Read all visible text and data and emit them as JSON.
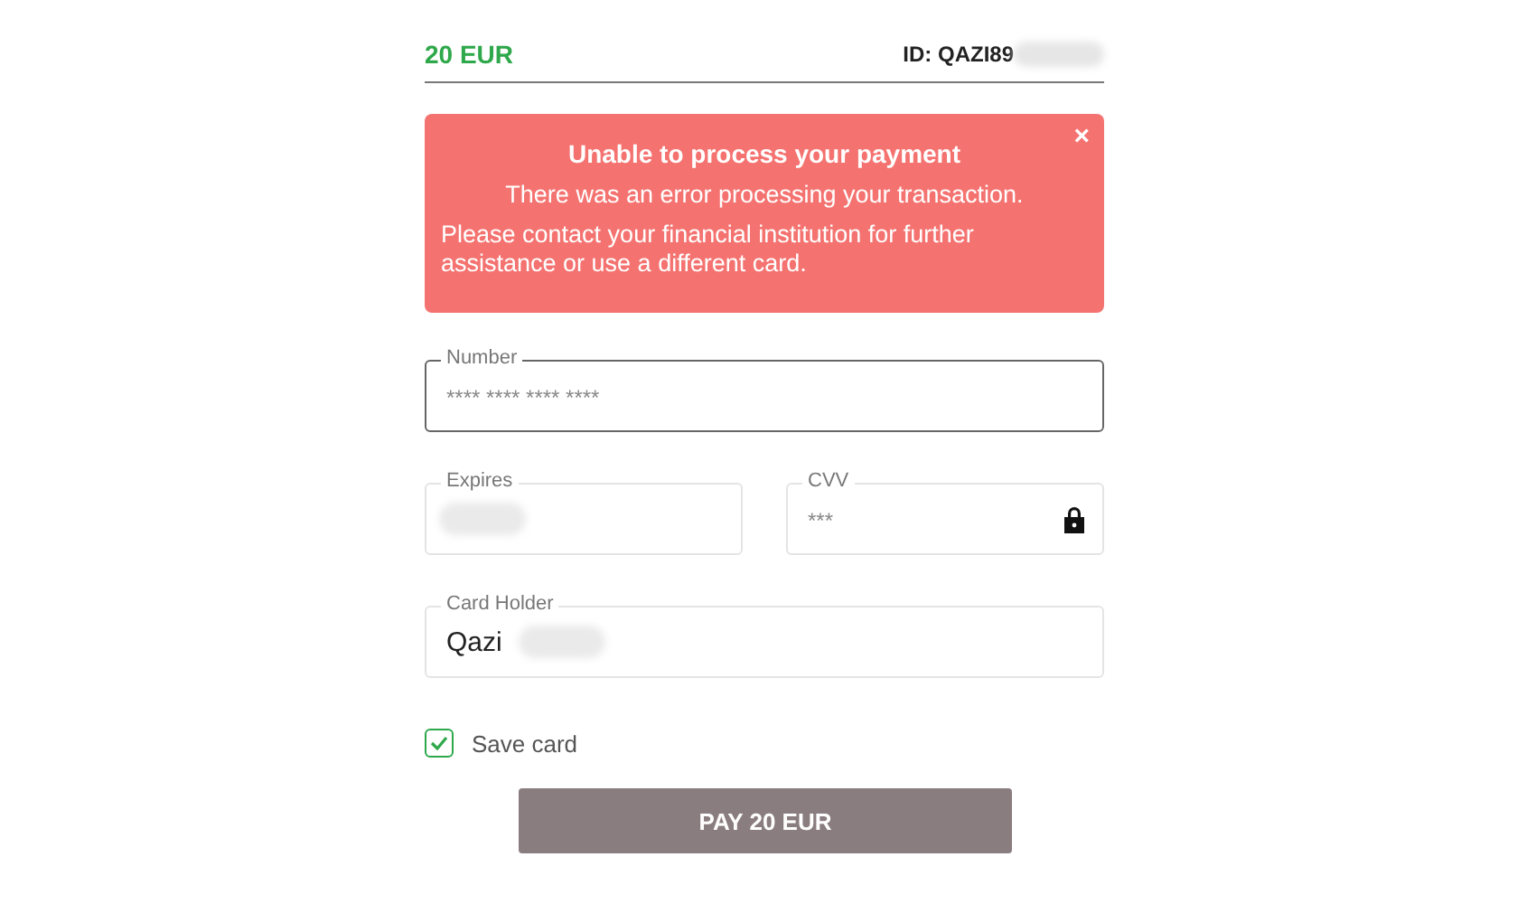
{
  "header": {
    "amount": "20 EUR",
    "order_id": "ID: QAZI89"
  },
  "alert": {
    "title": "Unable to process your payment",
    "message": "There was an error processing your transaction.",
    "detail": "Please contact your financial institution for further assistance or use a different card.",
    "close": "×"
  },
  "fields": [
    {
      "label": "Number",
      "placeholder": "**** **** **** ****",
      "focused": true
    },
    {
      "label": "Expires",
      "focused": false,
      "redacted": true
    },
    {
      "label": "CVV",
      "placeholder": "***",
      "focused": false,
      "lock": true
    },
    {
      "label": "Card Holder",
      "value": "Qazi",
      "focused": false,
      "redacted": true
    }
  ],
  "save_card": {
    "label": "Save card",
    "checked": true
  },
  "pay_button": {
    "label": "PAY 20 EUR"
  }
}
